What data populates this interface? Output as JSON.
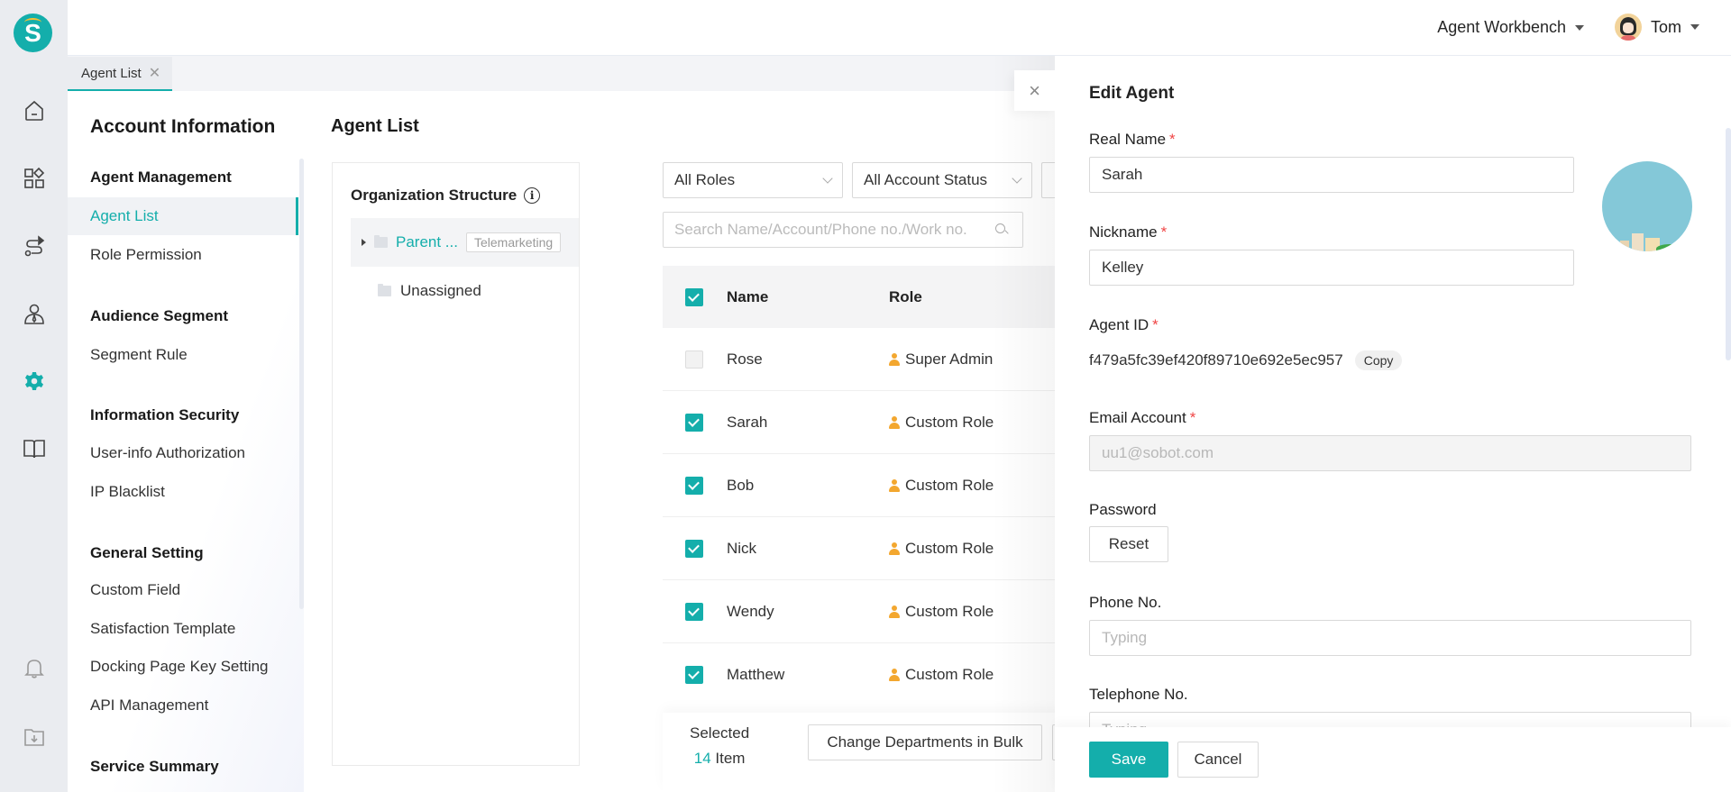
{
  "app": {
    "logo_letter": "S"
  },
  "rail": {
    "items": [
      {
        "name": "home-icon"
      },
      {
        "name": "apps-icon"
      },
      {
        "name": "route-icon"
      },
      {
        "name": "agent-icon"
      },
      {
        "name": "settings-icon",
        "active": true
      },
      {
        "name": "book-icon"
      },
      {
        "name": "bell-icon"
      },
      {
        "name": "download-folder-icon"
      }
    ],
    "active_color": "#14aeab"
  },
  "header": {
    "workspace_label": "Agent Workbench",
    "user_name": "Tom"
  },
  "tabs": [
    {
      "label": "Agent List",
      "closable": true,
      "active": true
    }
  ],
  "settings_menu": {
    "title": "Account Information",
    "groups": [
      {
        "label": "Agent Management",
        "items": [
          {
            "label": "Agent List",
            "active": true
          },
          {
            "label": "Role Permission"
          }
        ]
      },
      {
        "label": "Audience Segment",
        "items": [
          {
            "label": "Segment Rule"
          }
        ]
      },
      {
        "label": "Information Security",
        "items": [
          {
            "label": "User-info Authorization"
          },
          {
            "label": "IP Blacklist"
          }
        ]
      },
      {
        "label": "General Setting",
        "items": [
          {
            "label": "Custom Field"
          },
          {
            "label": "Satisfaction Template"
          },
          {
            "label": "Docking Page Key Setting"
          },
          {
            "label": "API Management"
          }
        ]
      },
      {
        "label": "Service Summary",
        "items": []
      }
    ]
  },
  "main": {
    "title": "Agent List",
    "org": {
      "title": "Organization Structure",
      "info_icon": "i",
      "root_node": {
        "name": "Parent ...",
        "tag": "Telemarketing",
        "more": "⋮"
      },
      "unassigned": "Unassigned"
    },
    "filters": {
      "roles": "All Roles",
      "account_status": "All Account Status"
    },
    "search": {
      "placeholder": "Search Name/Account/Phone no./Work no.",
      "value": ""
    },
    "table": {
      "header_checked": true,
      "columns": [
        "Name",
        "Role"
      ],
      "rows": [
        {
          "name": "Rose",
          "role": "Super Admin",
          "checked": false
        },
        {
          "name": "Sarah",
          "role": "Custom Role",
          "checked": true
        },
        {
          "name": "Bob",
          "role": "Custom Role",
          "checked": true
        },
        {
          "name": "Nick",
          "role": "Custom Role",
          "checked": true
        },
        {
          "name": "Wendy",
          "role": "Custom Role",
          "checked": true
        },
        {
          "name": "Matthew",
          "role": "Custom Role",
          "checked": true
        }
      ]
    },
    "bulk": {
      "selected_label": "Selected",
      "selected_count": "14",
      "item_label": "Item",
      "change_departments": "Change Departments in Bulk"
    }
  },
  "drawer": {
    "close_icon": "×",
    "title": "Edit Agent",
    "fields": {
      "real_name": {
        "label": "Real Name",
        "required": "*",
        "value": "Sarah"
      },
      "nickname": {
        "label": "Nickname",
        "required": "*",
        "value": "Kelley"
      },
      "agent_id": {
        "label": "Agent ID",
        "required": "*",
        "value": "f479a5fc39ef420f89710e692e5ec957",
        "copy_label": "Copy"
      },
      "email": {
        "label": "Email Account",
        "required": "*",
        "value": "uu1@sobot.com"
      },
      "password": {
        "label": "Password",
        "reset_label": "Reset"
      },
      "phone": {
        "label": "Phone No.",
        "placeholder": "Typing",
        "value": ""
      },
      "telephone": {
        "label": "Telephone No.",
        "placeholder": "Typing",
        "value": ""
      }
    },
    "save_label": "Save",
    "cancel_label": "Cancel"
  }
}
